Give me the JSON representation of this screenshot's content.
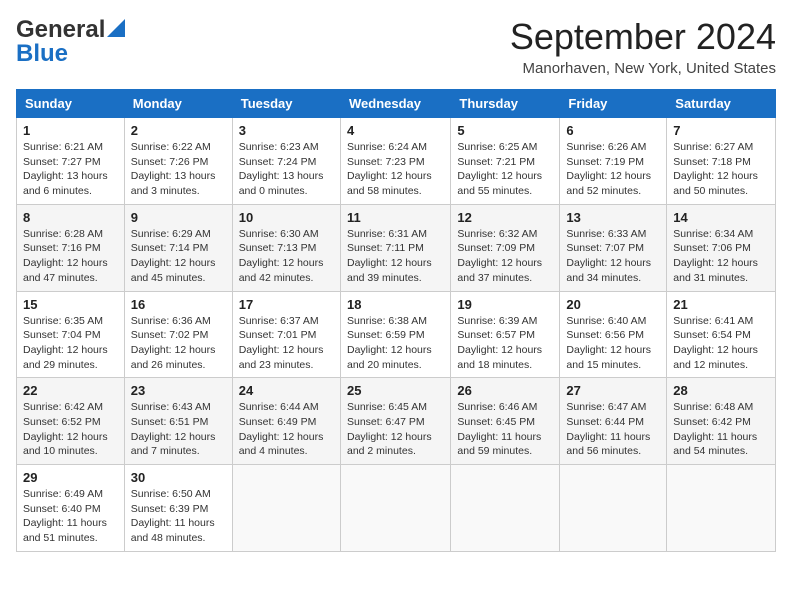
{
  "logo": {
    "line1": "General",
    "line2": "Blue"
  },
  "header": {
    "month": "September 2024",
    "location": "Manorhaven, New York, United States"
  },
  "weekdays": [
    "Sunday",
    "Monday",
    "Tuesday",
    "Wednesday",
    "Thursday",
    "Friday",
    "Saturday"
  ],
  "weeks": [
    [
      {
        "day": "1",
        "info": "Sunrise: 6:21 AM\nSunset: 7:27 PM\nDaylight: 13 hours\nand 6 minutes."
      },
      {
        "day": "2",
        "info": "Sunrise: 6:22 AM\nSunset: 7:26 PM\nDaylight: 13 hours\nand 3 minutes."
      },
      {
        "day": "3",
        "info": "Sunrise: 6:23 AM\nSunset: 7:24 PM\nDaylight: 13 hours\nand 0 minutes."
      },
      {
        "day": "4",
        "info": "Sunrise: 6:24 AM\nSunset: 7:23 PM\nDaylight: 12 hours\nand 58 minutes."
      },
      {
        "day": "5",
        "info": "Sunrise: 6:25 AM\nSunset: 7:21 PM\nDaylight: 12 hours\nand 55 minutes."
      },
      {
        "day": "6",
        "info": "Sunrise: 6:26 AM\nSunset: 7:19 PM\nDaylight: 12 hours\nand 52 minutes."
      },
      {
        "day": "7",
        "info": "Sunrise: 6:27 AM\nSunset: 7:18 PM\nDaylight: 12 hours\nand 50 minutes."
      }
    ],
    [
      {
        "day": "8",
        "info": "Sunrise: 6:28 AM\nSunset: 7:16 PM\nDaylight: 12 hours\nand 47 minutes."
      },
      {
        "day": "9",
        "info": "Sunrise: 6:29 AM\nSunset: 7:14 PM\nDaylight: 12 hours\nand 45 minutes."
      },
      {
        "day": "10",
        "info": "Sunrise: 6:30 AM\nSunset: 7:13 PM\nDaylight: 12 hours\nand 42 minutes."
      },
      {
        "day": "11",
        "info": "Sunrise: 6:31 AM\nSunset: 7:11 PM\nDaylight: 12 hours\nand 39 minutes."
      },
      {
        "day": "12",
        "info": "Sunrise: 6:32 AM\nSunset: 7:09 PM\nDaylight: 12 hours\nand 37 minutes."
      },
      {
        "day": "13",
        "info": "Sunrise: 6:33 AM\nSunset: 7:07 PM\nDaylight: 12 hours\nand 34 minutes."
      },
      {
        "day": "14",
        "info": "Sunrise: 6:34 AM\nSunset: 7:06 PM\nDaylight: 12 hours\nand 31 minutes."
      }
    ],
    [
      {
        "day": "15",
        "info": "Sunrise: 6:35 AM\nSunset: 7:04 PM\nDaylight: 12 hours\nand 29 minutes."
      },
      {
        "day": "16",
        "info": "Sunrise: 6:36 AM\nSunset: 7:02 PM\nDaylight: 12 hours\nand 26 minutes."
      },
      {
        "day": "17",
        "info": "Sunrise: 6:37 AM\nSunset: 7:01 PM\nDaylight: 12 hours\nand 23 minutes."
      },
      {
        "day": "18",
        "info": "Sunrise: 6:38 AM\nSunset: 6:59 PM\nDaylight: 12 hours\nand 20 minutes."
      },
      {
        "day": "19",
        "info": "Sunrise: 6:39 AM\nSunset: 6:57 PM\nDaylight: 12 hours\nand 18 minutes."
      },
      {
        "day": "20",
        "info": "Sunrise: 6:40 AM\nSunset: 6:56 PM\nDaylight: 12 hours\nand 15 minutes."
      },
      {
        "day": "21",
        "info": "Sunrise: 6:41 AM\nSunset: 6:54 PM\nDaylight: 12 hours\nand 12 minutes."
      }
    ],
    [
      {
        "day": "22",
        "info": "Sunrise: 6:42 AM\nSunset: 6:52 PM\nDaylight: 12 hours\nand 10 minutes."
      },
      {
        "day": "23",
        "info": "Sunrise: 6:43 AM\nSunset: 6:51 PM\nDaylight: 12 hours\nand 7 minutes."
      },
      {
        "day": "24",
        "info": "Sunrise: 6:44 AM\nSunset: 6:49 PM\nDaylight: 12 hours\nand 4 minutes."
      },
      {
        "day": "25",
        "info": "Sunrise: 6:45 AM\nSunset: 6:47 PM\nDaylight: 12 hours\nand 2 minutes."
      },
      {
        "day": "26",
        "info": "Sunrise: 6:46 AM\nSunset: 6:45 PM\nDaylight: 11 hours\nand 59 minutes."
      },
      {
        "day": "27",
        "info": "Sunrise: 6:47 AM\nSunset: 6:44 PM\nDaylight: 11 hours\nand 56 minutes."
      },
      {
        "day": "28",
        "info": "Sunrise: 6:48 AM\nSunset: 6:42 PM\nDaylight: 11 hours\nand 54 minutes."
      }
    ],
    [
      {
        "day": "29",
        "info": "Sunrise: 6:49 AM\nSunset: 6:40 PM\nDaylight: 11 hours\nand 51 minutes."
      },
      {
        "day": "30",
        "info": "Sunrise: 6:50 AM\nSunset: 6:39 PM\nDaylight: 11 hours\nand 48 minutes."
      },
      null,
      null,
      null,
      null,
      null
    ]
  ]
}
